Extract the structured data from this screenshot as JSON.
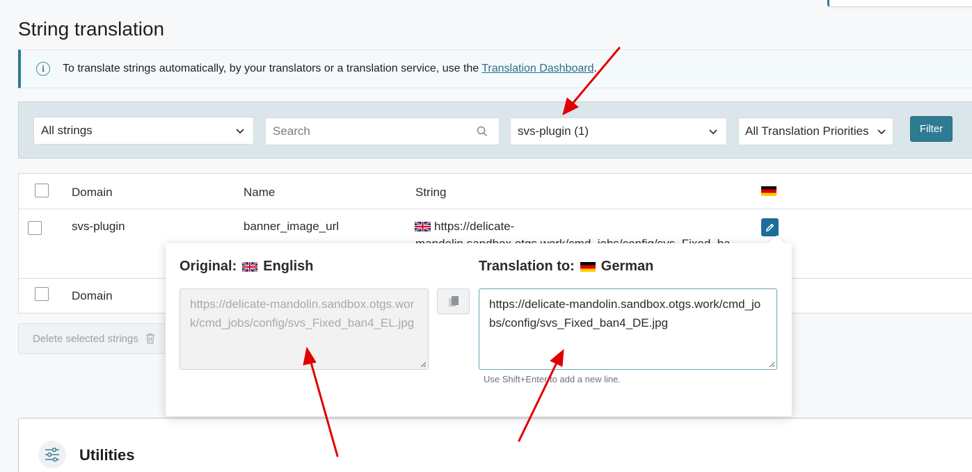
{
  "page": {
    "title": "String translation"
  },
  "notice": {
    "text": "To translate strings automatically, by your translators or a translation service, use the",
    "link": "Translation Dashboard",
    "suffix": "."
  },
  "filters": {
    "strings_select": "All strings",
    "search_placeholder": "Search",
    "domain_select": "svs-plugin (1)",
    "priority_select": "All Translation Priorities",
    "filter_button": "Filter"
  },
  "table": {
    "headers": {
      "domain": "Domain",
      "name": "Name",
      "string": "String"
    },
    "row": {
      "domain": "svs-plugin",
      "name": "banner_image_url",
      "string_line1": "https://delicate-",
      "string_line2": "mandolin.sandbox.otgs.work/cmd_jobs/config/svs_Fixed_ba"
    },
    "footer": {
      "domain": "Domain"
    }
  },
  "actions": {
    "delete_selected": "Delete selected strings"
  },
  "utilities": {
    "title": "Utilities"
  },
  "popup": {
    "original_label": "Original:",
    "original_language": "English",
    "original_value": "https://delicate-mandolin.sandbox.otgs.work/cmd_jobs/config/svs_Fixed_ban4_EL.jpg",
    "translation_label": "Translation to:",
    "translation_language": "German",
    "translation_value": "https://delicate-mandolin.sandbox.otgs.work/cmd_jobs/config/svs_Fixed_ban4_DE.jpg",
    "hint": "Use Shift+Enter to add a new line."
  },
  "colors": {
    "accent": "#2f7b93",
    "annotation_arrow": "#e00000",
    "edit_button": "#1d6d9a"
  }
}
